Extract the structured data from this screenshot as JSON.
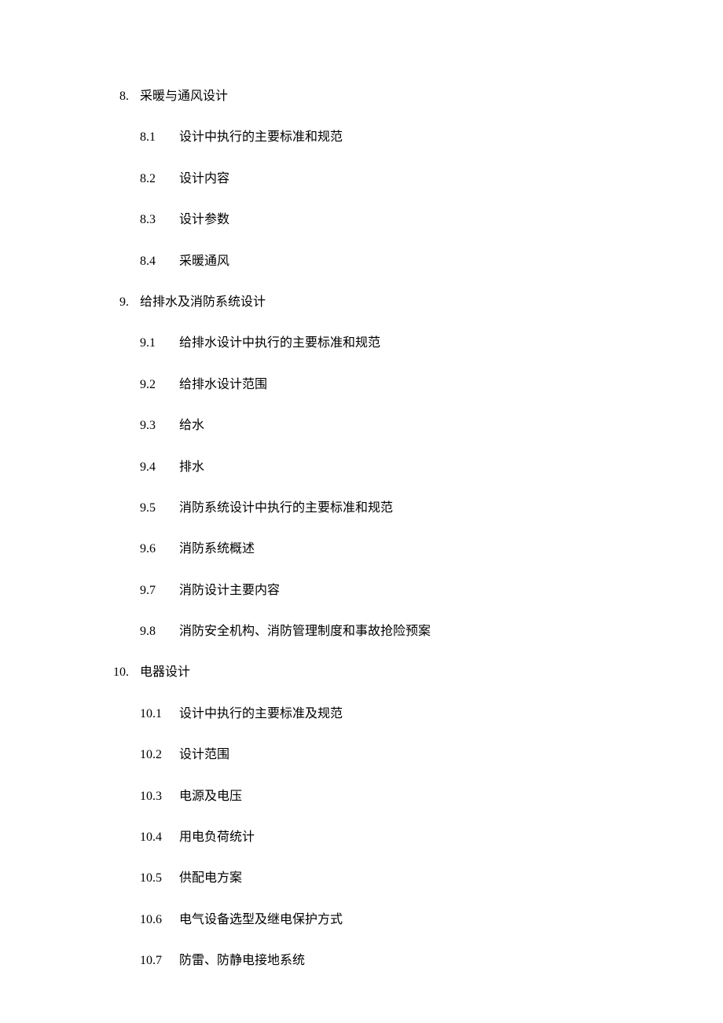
{
  "sections": [
    {
      "number": "8.",
      "title": "采暖与通风设计",
      "subsections": [
        {
          "number": "8.1",
          "title": "设计中执行的主要标准和规范"
        },
        {
          "number": "8.2",
          "title": "设计内容"
        },
        {
          "number": "8.3",
          "title": "设计参数"
        },
        {
          "number": "8.4",
          "title": "采暖通风"
        }
      ]
    },
    {
      "number": "9.",
      "title": "给排水及消防系统设计",
      "subsections": [
        {
          "number": "9.1",
          "title": "给排水设计中执行的主要标准和规范"
        },
        {
          "number": "9.2",
          "title": "给排水设计范围"
        },
        {
          "number": "9.3",
          "title": "给水"
        },
        {
          "number": "9.4",
          "title": "排水"
        },
        {
          "number": "9.5",
          "title": "消防系统设计中执行的主要标准和规范"
        },
        {
          "number": "9.6",
          "title": "消防系统概述"
        },
        {
          "number": "9.7",
          "title": "消防设计主要内容"
        },
        {
          "number": "9.8",
          "title": "消防安全机构、消防管理制度和事故抢险预案"
        }
      ]
    },
    {
      "number": "10.",
      "title": "电器设计",
      "subsections": [
        {
          "number": "10.1",
          "title": "设计中执行的主要标准及规范"
        },
        {
          "number": "10.2",
          "title": "设计范围"
        },
        {
          "number": "10.3",
          "title": "电源及电压"
        },
        {
          "number": "10.4",
          "title": "用电负荷统计"
        },
        {
          "number": "10.5",
          "title": "供配电方案"
        },
        {
          "number": "10.6",
          "title": "电气设备选型及继电保护方式"
        },
        {
          "number": "10.7",
          "title": "防雷、防静电接地系统"
        }
      ]
    }
  ]
}
